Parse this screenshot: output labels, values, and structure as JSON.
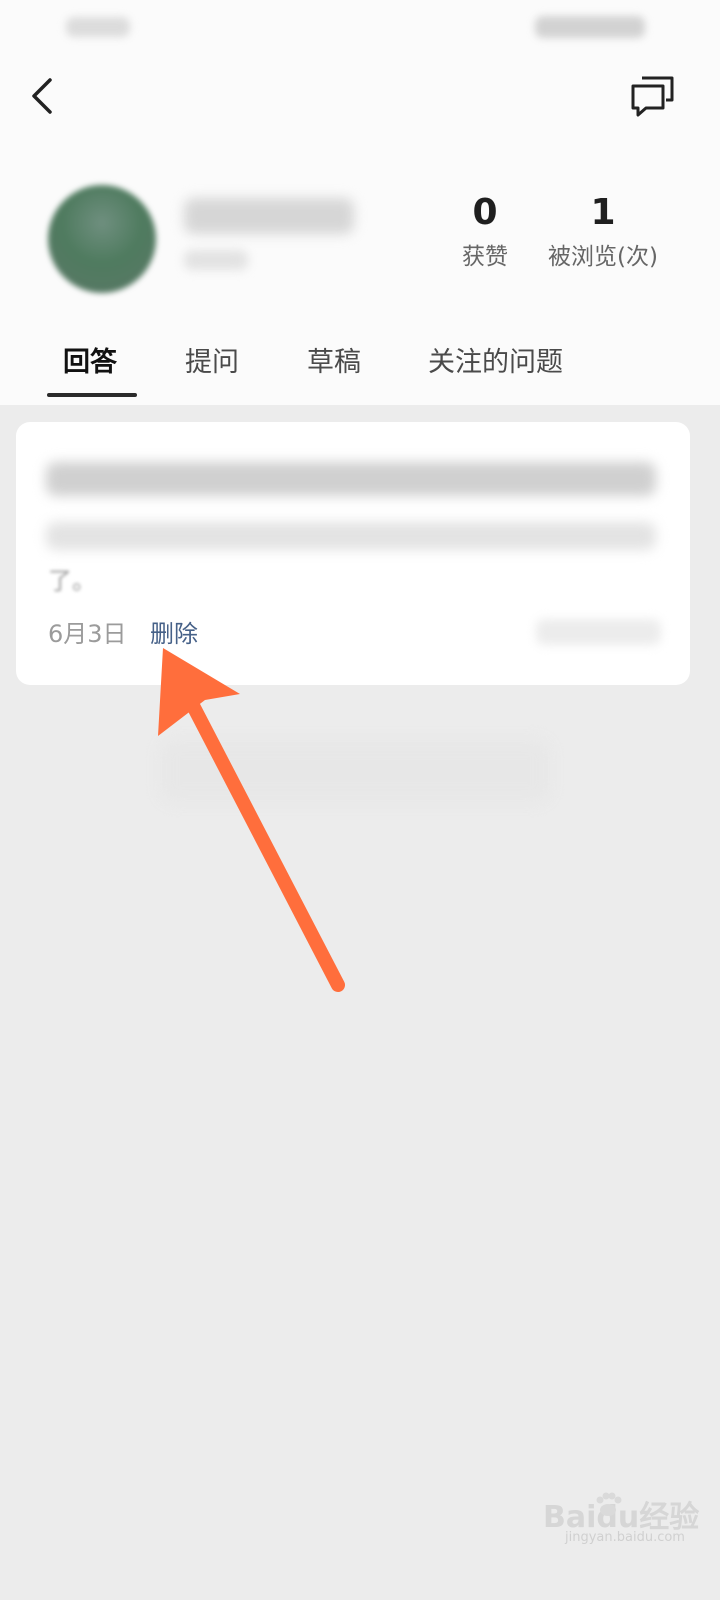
{
  "profile": {
    "stats": [
      {
        "value": "0",
        "label": "获赞"
      },
      {
        "value": "1",
        "label": "被浏览(次)"
      }
    ]
  },
  "tabs": [
    {
      "label": "回答",
      "active": true
    },
    {
      "label": "提问",
      "active": false
    },
    {
      "label": "草稿",
      "active": false
    },
    {
      "label": "关注的问题",
      "active": false
    }
  ],
  "answer_card": {
    "excerpt_tail": "了。",
    "date": "6月3日",
    "delete_label": "删除"
  },
  "colors": {
    "annotation_arrow": "#ff6e3c",
    "delete_link": "#466188"
  },
  "icons": {
    "back": "back-chevron-icon",
    "messages": "messages-icon",
    "annotation": "arrow-annotation-icon"
  },
  "watermark": {
    "brand": "Baidu经验",
    "url": "jingyan.baidu.com"
  }
}
